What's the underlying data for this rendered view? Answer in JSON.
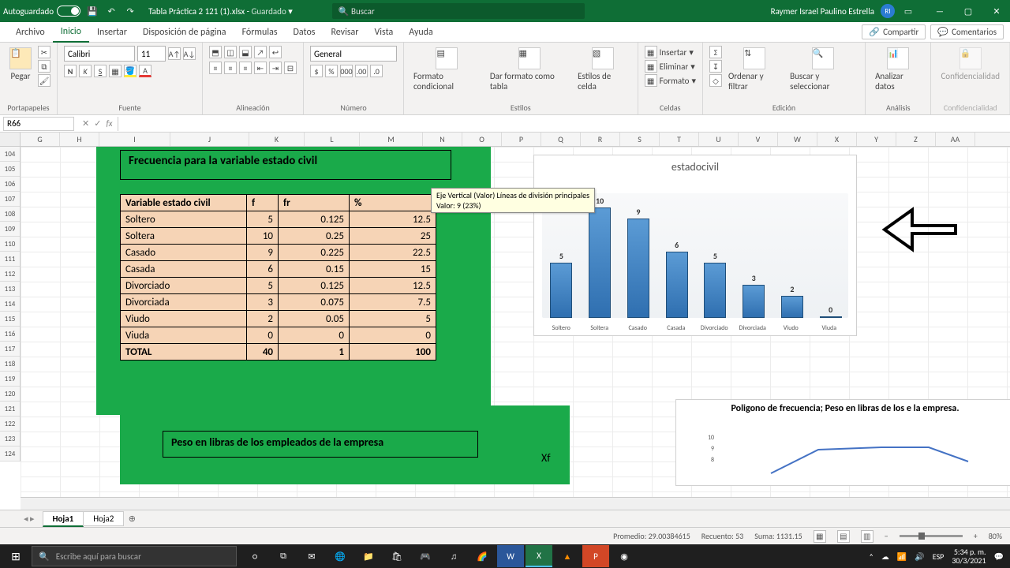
{
  "titlebar": {
    "autosave": "Autoguardado",
    "doc": "Tabla Práctica 2 121 (1).xlsx",
    "saved": "Guardado",
    "search_ph": "Buscar",
    "user": "Raymer Israel Paulino Estrella",
    "initials": "RI"
  },
  "tabs": {
    "archivo": "Archivo",
    "inicio": "Inicio",
    "insertar": "Insertar",
    "disposicion": "Disposición de página",
    "formulas": "Fórmulas",
    "datos": "Datos",
    "revisar": "Revisar",
    "vista": "Vista",
    "ayuda": "Ayuda",
    "compartir": "Compartir",
    "comentarios": "Comentarios"
  },
  "ribbon": {
    "pegar": "Pegar",
    "portapapeles": "Portapapeles",
    "font_name": "Calibri",
    "font_size": "11",
    "fuente": "Fuente",
    "alineacion": "Alineación",
    "num_format": "General",
    "numero": "Número",
    "formato_cond": "Formato condicional",
    "dar_formato": "Dar formato como tabla",
    "estilos_celda": "Estilos de celda",
    "estilos": "Estilos",
    "insertar": "Insertar",
    "eliminar": "Eliminar",
    "formato": "Formato",
    "celdas": "Celdas",
    "ordenar": "Ordenar y filtrar",
    "buscar": "Buscar y seleccionar",
    "edicion": "Edición",
    "analizar": "Analizar datos",
    "analisis": "Análisis",
    "confid": "Confidencialidad",
    "confid_grp": "Confidencialidad"
  },
  "namebox": "R66",
  "fx_label": "fx",
  "cols": [
    "G",
    "H",
    "I",
    "J",
    "K",
    "L",
    "M",
    "N",
    "O",
    "P",
    "Q",
    "R",
    "S",
    "T",
    "U",
    "V",
    "W",
    "X",
    "Y",
    "Z",
    "AA"
  ],
  "rows": [
    "104",
    "105",
    "106",
    "107",
    "108",
    "109",
    "110",
    "111",
    "112",
    "113",
    "114",
    "115",
    "116",
    "117",
    "118",
    "119",
    "120",
    "121",
    "122",
    "123",
    "124"
  ],
  "table_title": "Frecuencia para la variable estado civil",
  "table_headers": {
    "var": "Variable estado civil",
    "f": "f",
    "fr": "fr",
    "pct": "%"
  },
  "table_rows": [
    {
      "cat": "Soltero",
      "f": "5",
      "fr": "0.125",
      "pct": "12.5"
    },
    {
      "cat": "Soltera",
      "f": "10",
      "fr": "0.25",
      "pct": "25"
    },
    {
      "cat": "Casado",
      "f": "9",
      "fr": "0.225",
      "pct": "22.5"
    },
    {
      "cat": "Casada",
      "f": "6",
      "fr": "0.15",
      "pct": "15"
    },
    {
      "cat": "Divorciado",
      "f": "5",
      "fr": "0.125",
      "pct": "12.5"
    },
    {
      "cat": "Divorciada",
      "f": "3",
      "fr": "0.075",
      "pct": "7.5"
    },
    {
      "cat": "Viudo",
      "f": "2",
      "fr": "0.05",
      "pct": "5"
    },
    {
      "cat": "Viuda",
      "f": "0",
      "fr": "0",
      "pct": "0"
    }
  ],
  "table_total": {
    "cat": "TOTAL",
    "f": "40",
    "fr": "1",
    "pct": "100"
  },
  "tooltip": {
    "l1": "Eje Vertical (Valor)  Líneas de división principales",
    "l2": "Valor: 9 (23%)"
  },
  "chart_data": {
    "type": "bar",
    "title": "estadocivil",
    "categories": [
      "Soltero",
      "Soltera",
      "Casado",
      "Casada",
      "Divorciado",
      "Divorciada",
      "Viudo",
      "Viuda"
    ],
    "values": [
      5,
      10,
      9,
      6,
      5,
      3,
      2,
      0
    ],
    "ylim": [
      0,
      10
    ]
  },
  "chart2_title": "Poligono de frecuencia; Peso en libras de los e la empresa.",
  "section2_title": "Peso en libras de los empleados de la empresa",
  "xf_label": "Xf",
  "sheets": {
    "s1": "Hoja1",
    "s2": "Hoja2"
  },
  "status": {
    "prom": "Promedio: 29.00384615",
    "rec": "Recuento: 53",
    "sum": "Suma: 1131.15",
    "zoom": "80%"
  },
  "taskbar": {
    "search_ph": "Escribe aquí para buscar",
    "lang": "ESP",
    "time": "5:34 p. m.",
    "date": "30/3/2021",
    "temp": ""
  }
}
